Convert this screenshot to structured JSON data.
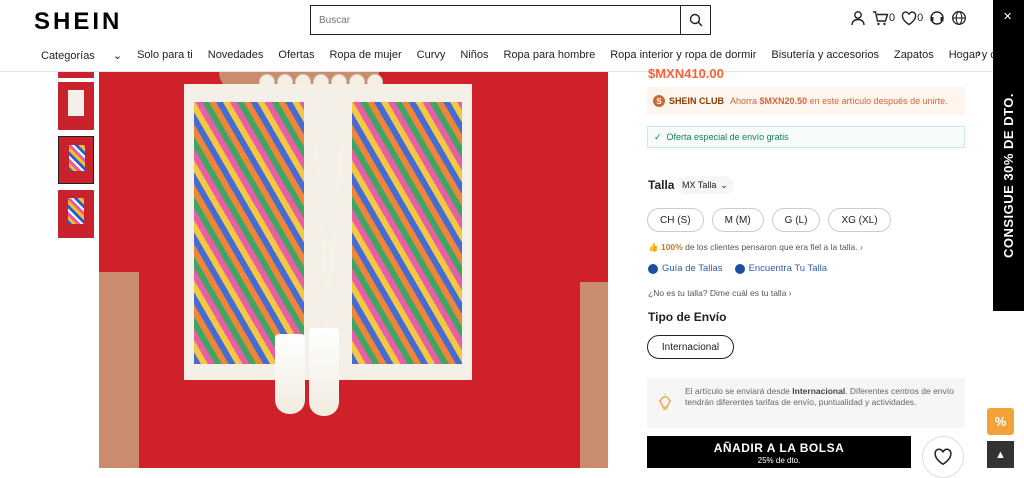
{
  "header": {
    "logo": "SHEIN",
    "search_placeholder": "Buscar",
    "cart_count": "0",
    "wishlist_count": "0"
  },
  "nav": {
    "items": [
      "Categorías",
      "Solo para ti",
      "Novedades",
      "Ofertas",
      "Ropa de mujer",
      "Curvy",
      "Niños",
      "Ropa para hombre",
      "Ropa interior y ropa de dormir",
      "Bisutería y accesorios",
      "Zapatos",
      "Hogar y cocina"
    ]
  },
  "product": {
    "price": "$MXN410.00",
    "club": {
      "name": "SHEIN CLUB",
      "text_before": "Ahorra",
      "amount": "$MXN20.50",
      "text_after": "en este artículo después de unirte."
    },
    "shipping_offer": "Oferta especial de envío gratis",
    "size_label": "Talla",
    "size_system": "MX Talla",
    "sizes": [
      "CH (S)",
      "M (M)",
      "G (L)",
      "XG (XL)"
    ],
    "fit_pct": "100%",
    "fit_text": "de los clientes pensaron que era fiel a la talla.",
    "size_guide": "Guía de Tallas",
    "find_size": "Encuentra Tu Talla",
    "ask_size": "¿No es tu talla? Dime cuál es tu talla",
    "shipping_type_label": "Tipo de Envío",
    "shipping_type": "Internacional",
    "note_prefix": "El artículo se enviará desde",
    "note_bold": "Internacional",
    "note_rest": ". Diferentes centros de envío tendrán diferentes tarifas de envío, puntualidad y actividades.",
    "add_to_bag": "AÑADIR A LA BOLSA",
    "add_sub": "25% de dto."
  },
  "promo": {
    "side_text": "CONSIGUE 30% DE DTO.",
    "percent_badge": "%"
  },
  "colors": {
    "price": "#fa6338",
    "link": "#2f5ea6",
    "garment": "#d0202a"
  }
}
